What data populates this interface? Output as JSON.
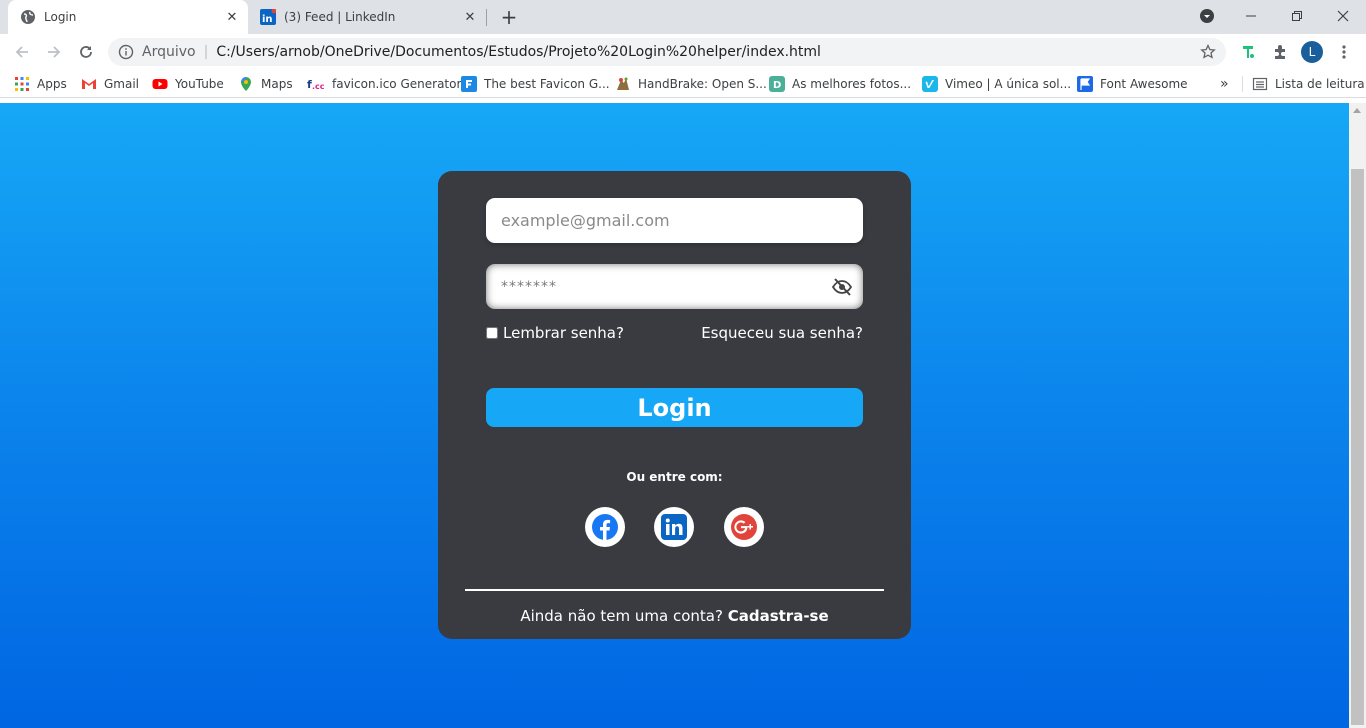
{
  "browser": {
    "tabs": [
      {
        "title": "Login",
        "active": true
      },
      {
        "title": "(3) Feed | LinkedIn",
        "active": false
      }
    ],
    "new_tab": "+",
    "address": {
      "security_label": "Arquivo",
      "url": "C:/Users/arnob/OneDrive/Documentos/Estudos/Projeto%20Login%20helper/index.html"
    },
    "profile_initial": "L",
    "bookmarks": [
      {
        "label": "Apps",
        "icon": "apps-grid-icon"
      },
      {
        "label": "Gmail",
        "icon": "gmail-icon"
      },
      {
        "label": "YouTube",
        "icon": "youtube-icon"
      },
      {
        "label": "Maps",
        "icon": "maps-icon"
      },
      {
        "label": "favicon.ico Generator",
        "icon": "favicon-cc-icon"
      },
      {
        "label": "The best Favicon G...",
        "icon": "favicon-generator-icon"
      },
      {
        "label": "HandBrake: Open S...",
        "icon": "handbrake-icon"
      },
      {
        "label": "As melhores fotos...",
        "icon": "photos-d-icon"
      },
      {
        "label": "Vimeo | A única sol...",
        "icon": "vimeo-icon"
      },
      {
        "label": "Font Awesome",
        "icon": "font-awesome-flag-icon"
      }
    ],
    "bookmarks_overflow": "»",
    "reading_list": "Lista de leitura"
  },
  "login_form": {
    "email_placeholder": "example@gmail.com",
    "password_placeholder": "*******",
    "remember_label": "Lembrar senha?",
    "forgot_link": "Esqueceu sua senha?",
    "login_button": "Login",
    "alt_login_label": "Ou entre com:",
    "social": [
      "facebook-icon",
      "linkedin-icon",
      "google-plus-icon"
    ],
    "signup_prompt": "Ainda não tem uma conta? ",
    "signup_link": "Cadastra-se"
  },
  "colors": {
    "page_gradient_top": "#16a8f6",
    "page_gradient_bottom": "#0066e2",
    "card": "#393b40",
    "login_button": "#16a8f6"
  }
}
